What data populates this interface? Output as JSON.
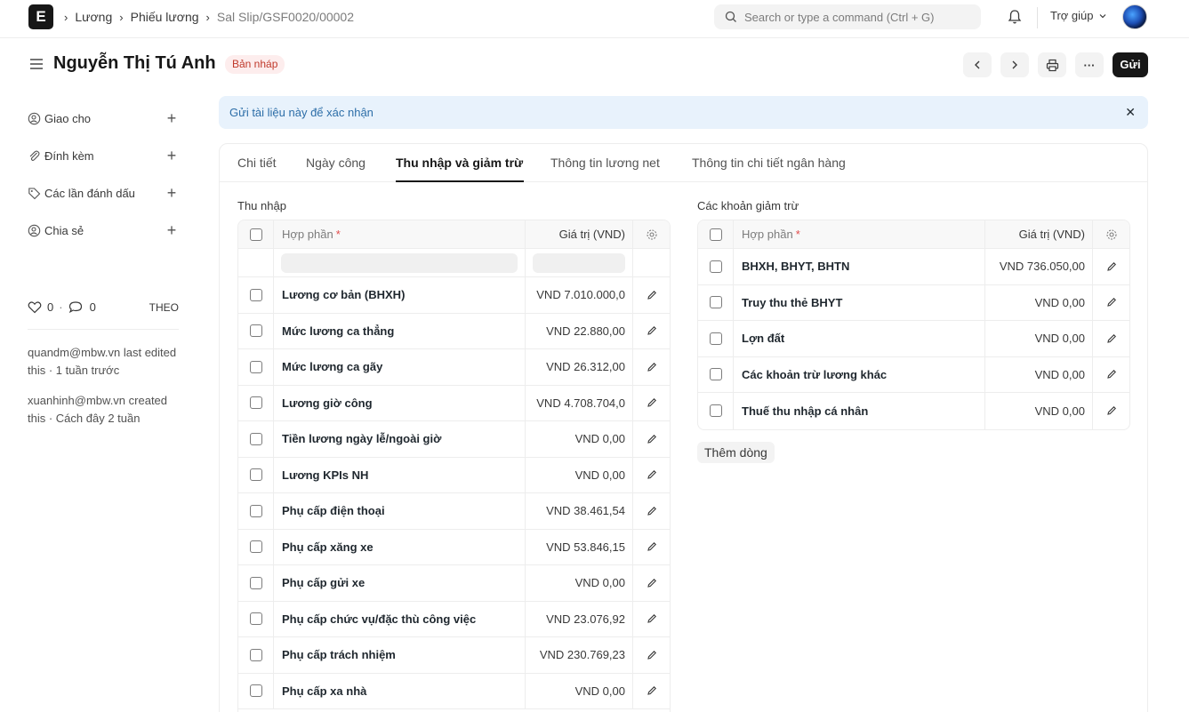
{
  "app": {
    "logo_letter": "E"
  },
  "breadcrumb": [
    "Lương",
    "Phiếu lương",
    "Sal Slip/GSF0020/00002"
  ],
  "search": {
    "placeholder": "Search or type a command (Ctrl + G)"
  },
  "help_label": "Trợ giúp",
  "header": {
    "title": "Nguyễn Thị Tú Anh",
    "status": "Bản nháp",
    "submit_label": "Gửi",
    "more_label": "···"
  },
  "sidebar": {
    "items": [
      {
        "label": "Giao cho",
        "icon": "user-plus-icon"
      },
      {
        "label": "Đính kèm",
        "icon": "paperclip-icon"
      },
      {
        "label": "Các lần đánh dấu",
        "icon": "tag-icon"
      },
      {
        "label": "Chia sẻ",
        "icon": "share-user-icon"
      }
    ],
    "likes": "0",
    "comments": "0",
    "follow_label": "THEO",
    "activity": [
      "quandm@mbw.vn last edited this · 1 tuần trước",
      "xuanhinh@mbw.vn created this · Cách đây 2 tuần"
    ]
  },
  "alert": {
    "text": "Gửi tài liệu này để xác nhận",
    "close": "✕"
  },
  "tabs": [
    "Chi tiết",
    "Ngày công",
    "Thu nhập và giảm trừ",
    "Thông tin lương net",
    "Thông tin chi tiết ngân hàng"
  ],
  "active_tab": "Thu nhập và giảm trừ",
  "earnings": {
    "title": "Thu nhập",
    "col_component": "Hợp phần",
    "col_amount": "Giá trị (VND)",
    "rows": [
      {
        "name": "Lương cơ bản (BHXH)",
        "amount": "VND 7.010.000,0"
      },
      {
        "name": "Mức lương ca thẳng",
        "amount": "VND 22.880,00"
      },
      {
        "name": "Mức lương ca gãy",
        "amount": "VND 26.312,00"
      },
      {
        "name": "Lương giờ công",
        "amount": "VND 4.708.704,0"
      },
      {
        "name": "Tiền lương ngày lễ/ngoài giờ",
        "amount": "VND 0,00"
      },
      {
        "name": "Lương KPIs NH",
        "amount": "VND 0,00"
      },
      {
        "name": "Phụ cấp điện thoại",
        "amount": "VND 38.461,54"
      },
      {
        "name": "Phụ cấp xăng xe",
        "amount": "VND 53.846,15"
      },
      {
        "name": "Phụ cấp gửi xe",
        "amount": "VND 0,00"
      },
      {
        "name": "Phụ cấp chức vụ/đặc thù công việc",
        "amount": "VND 23.076,92"
      },
      {
        "name": "Phụ cấp trách nhiệm",
        "amount": "VND 230.769,23"
      },
      {
        "name": "Phụ cấp xa nhà",
        "amount": "VND 0,00"
      }
    ]
  },
  "deductions": {
    "title": "Các khoản giảm trừ",
    "col_component": "Hợp phần",
    "col_amount": "Giá trị (VND)",
    "rows": [
      {
        "name": "BHXH, BHYT, BHTN",
        "amount": "VND 736.050,00"
      },
      {
        "name": "Truy thu thẻ BHYT",
        "amount": "VND 0,00"
      },
      {
        "name": "Lợn đất",
        "amount": "VND 0,00"
      },
      {
        "name": "Các khoản trừ lương khác",
        "amount": "VND 0,00"
      },
      {
        "name": "Thuế thu nhập cá nhân",
        "amount": "VND 0,00"
      }
    ],
    "add_row_label": "Thêm dòng"
  }
}
